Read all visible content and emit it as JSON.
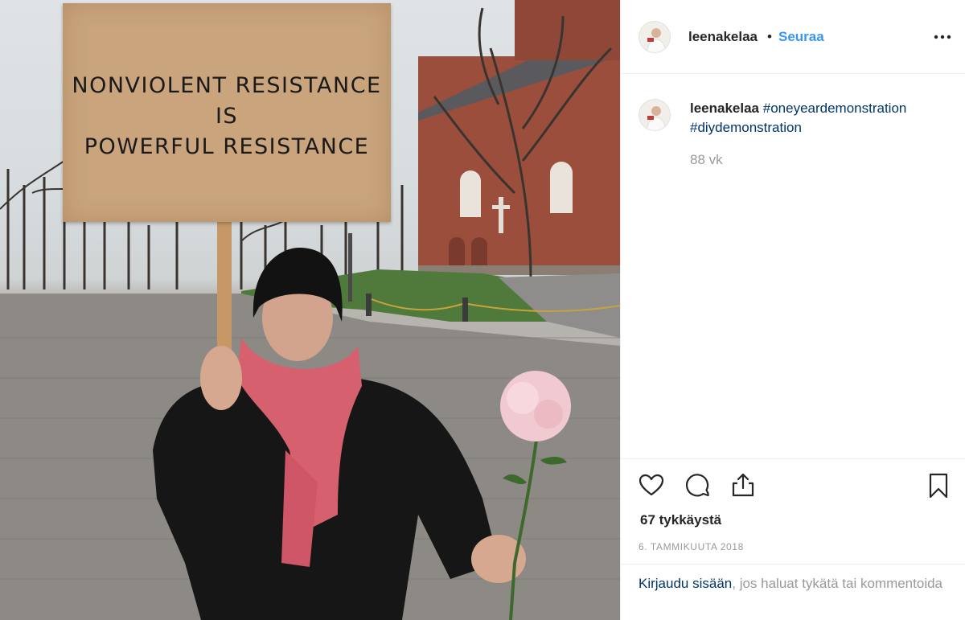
{
  "photo": {
    "sign_lines": [
      "NONVIOLENT RESISTANCE",
      "IS",
      "POWERFUL RESISTANCE"
    ]
  },
  "header": {
    "username": "leenakelaa",
    "separator": "•",
    "follow_label": "Seuraa",
    "more_icon": "more-horizontal-icon"
  },
  "caption": {
    "username": "leenakelaa",
    "hashtags": [
      "#oneyeardemonstration",
      "#diydemonstration"
    ],
    "time_ago": "88 vk"
  },
  "actions": {
    "icons": [
      "heart-icon",
      "comment-icon",
      "share-icon",
      "bookmark-icon"
    ],
    "likes": "67 tykkäystä",
    "date": "6. TAMMIKUUTA 2018"
  },
  "login": {
    "link": "Kirjaudu sisään",
    "rest": ", jos haluat tykätä tai kommentoida"
  },
  "colors": {
    "link_blue": "#3897f0",
    "hashtag_blue": "#003569",
    "muted": "#999999",
    "text": "#262626"
  }
}
